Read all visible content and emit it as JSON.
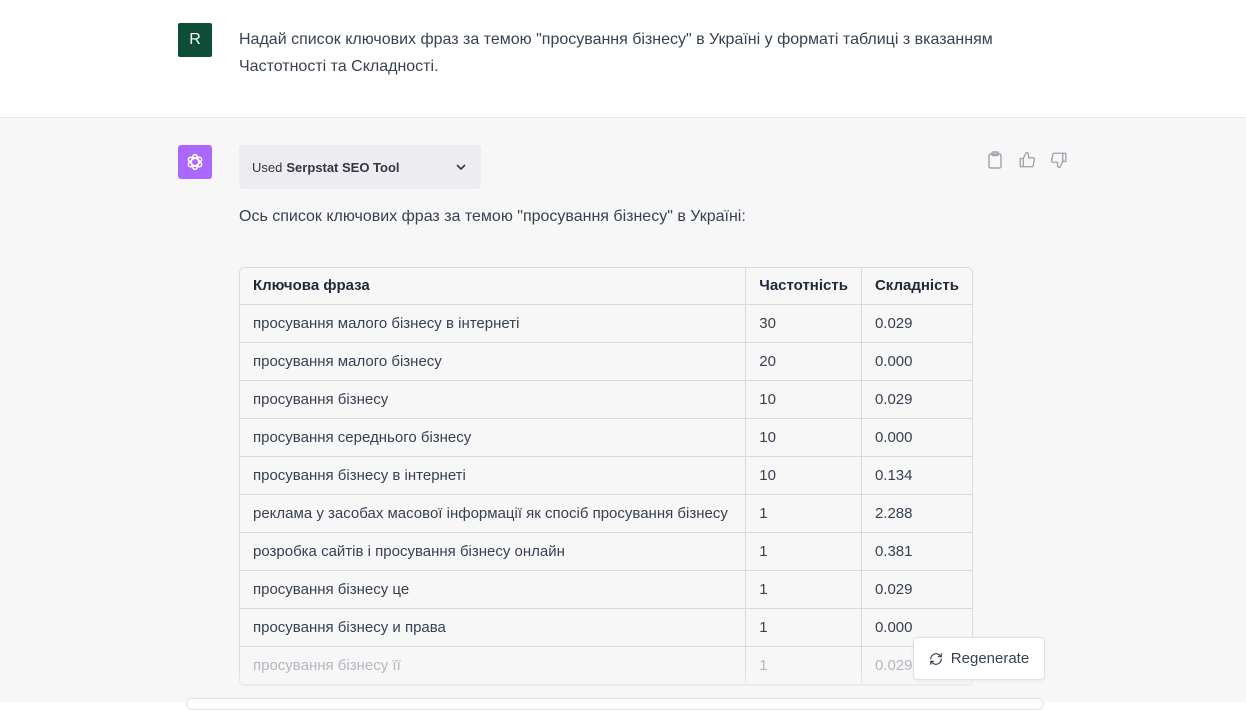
{
  "user_message": {
    "avatar_letter": "R",
    "text": "Надай список ключових фраз за темою \"просування бізнесу\" в Україні у форматі таблиці з вказанням Частотності та Складності."
  },
  "assistant_message": {
    "plugin": {
      "used_label": "Used",
      "tool_name": "Serpstat SEO Tool"
    },
    "intro": "Ось список ключових фраз за темою \"просування бізнесу\" в Україні:",
    "table": {
      "headers": [
        "Ключова фраза",
        "Частотність",
        "Складність"
      ],
      "rows": [
        [
          "просування малого бізнесу в інтернеті",
          "30",
          "0.029"
        ],
        [
          "просування малого бізнесу",
          "20",
          "0.000"
        ],
        [
          "просування бізнесу",
          "10",
          "0.029"
        ],
        [
          "просування середнього бізнесу",
          "10",
          "0.000"
        ],
        [
          "просування бізнесу в інтернеті",
          "10",
          "0.134"
        ],
        [
          "реклама у засобах масової інформації як спосіб просування бізнесу",
          "1",
          "2.288"
        ],
        [
          "розробка сайтів і просування бізнесу онлайн",
          "1",
          "0.381"
        ],
        [
          "просування бізнесу це",
          "1",
          "0.029"
        ],
        [
          "просування бізнесу и права",
          "1",
          "0.000"
        ],
        [
          "просування бізнесу її",
          "1",
          "0.029"
        ]
      ]
    }
  },
  "regenerate_label": "Regenerate",
  "colors": {
    "user_avatar": "#0f4c3a",
    "bot_avatar": "#ab68ff",
    "assistant_bg": "#f7f7f8"
  }
}
